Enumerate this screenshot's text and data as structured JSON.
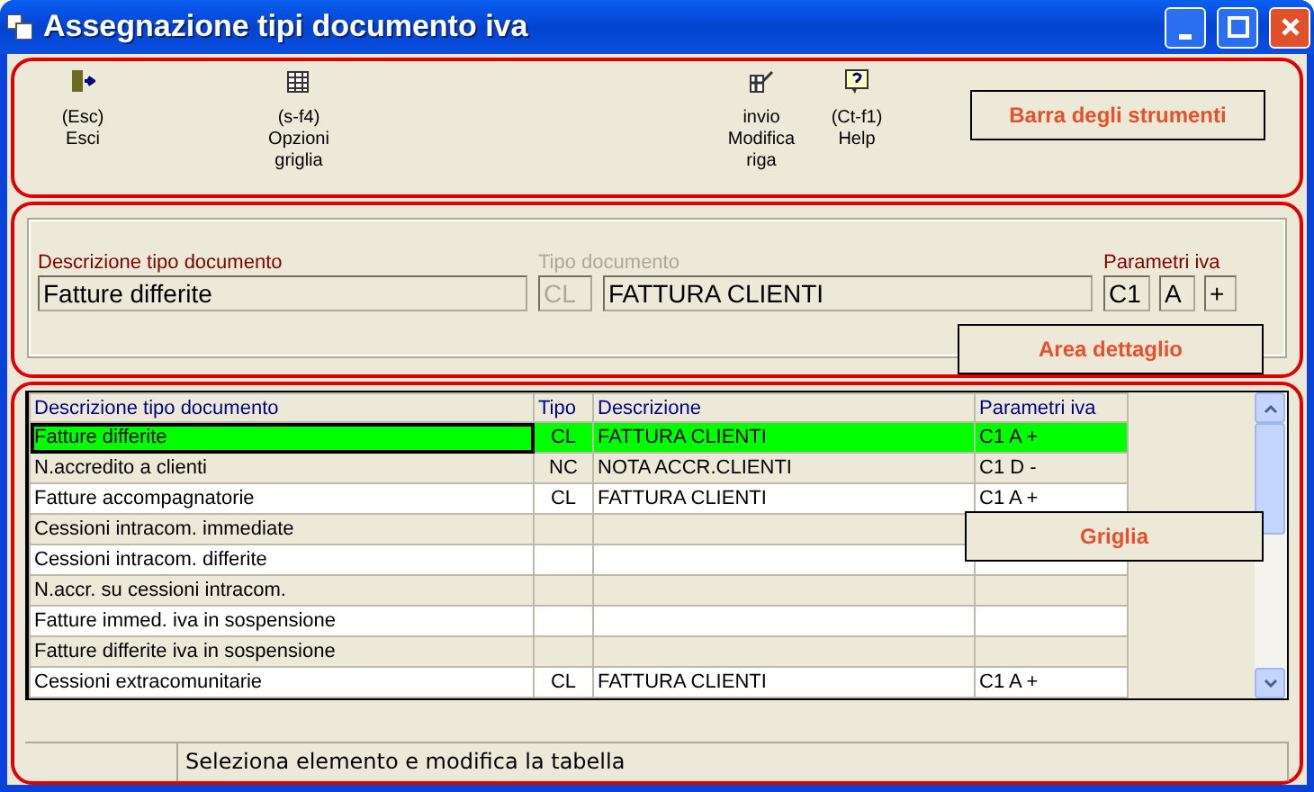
{
  "window": {
    "title": "Assegnazione tipi documento iva"
  },
  "toolbar": {
    "buttons": [
      {
        "key": "(Esc)",
        "label": "Esci"
      },
      {
        "key": "(s-f4)",
        "label": "Opzioni griglia"
      },
      {
        "key": "invio",
        "label": "Modifica riga"
      },
      {
        "key": "(Ct-f1)",
        "label": "Help"
      }
    ],
    "callout": "Barra degli strumenti"
  },
  "detail": {
    "fields": [
      {
        "label": "Descrizione tipo documento",
        "value": "Fatture differite",
        "disabled": false
      },
      {
        "label": "Tipo documento",
        "value": "CL",
        "disabled": true
      },
      {
        "value": "FATTURA CLIENTI",
        "disabled": false
      }
    ],
    "params_label": "Parametri iva",
    "params": [
      "C1",
      "A",
      "+"
    ],
    "callout": "Area dettaglio"
  },
  "grid": {
    "columns": [
      "Descrizione tipo documento",
      "Tipo",
      "Descrizione",
      "Parametri iva"
    ],
    "rows": [
      {
        "cells": [
          "Fatture differite",
          "CL",
          "FATTURA CLIENTI",
          "C1  A  +"
        ],
        "selected": true
      },
      {
        "cells": [
          "N.accredito a clienti",
          "NC",
          "NOTA ACCR.CLIENTI",
          "C1  D  -"
        ],
        "selected": false
      },
      {
        "cells": [
          "Fatture accompagnatorie",
          "CL",
          "FATTURA CLIENTI",
          "C1  A  +"
        ],
        "selected": false
      },
      {
        "cells": [
          "Cessioni intracom. immediate",
          "",
          "",
          ""
        ],
        "selected": false
      },
      {
        "cells": [
          "Cessioni intracom. differite",
          "",
          "",
          ""
        ],
        "selected": false
      },
      {
        "cells": [
          "N.accr. su cessioni intracom.",
          "",
          "",
          ""
        ],
        "selected": false
      },
      {
        "cells": [
          "Fatture immed. iva in sospensione",
          "",
          "",
          ""
        ],
        "selected": false
      },
      {
        "cells": [
          "Fatture differite iva in sospensione",
          "",
          "",
          ""
        ],
        "selected": false
      },
      {
        "cells": [
          "Cessioni extracomunitarie",
          "CL",
          "FATTURA CLIENTI",
          "C1  A  +"
        ],
        "selected": false
      }
    ],
    "callout": "Griglia"
  },
  "status_bar": {
    "text": "Seleziona elemento e modifica la tabella"
  }
}
